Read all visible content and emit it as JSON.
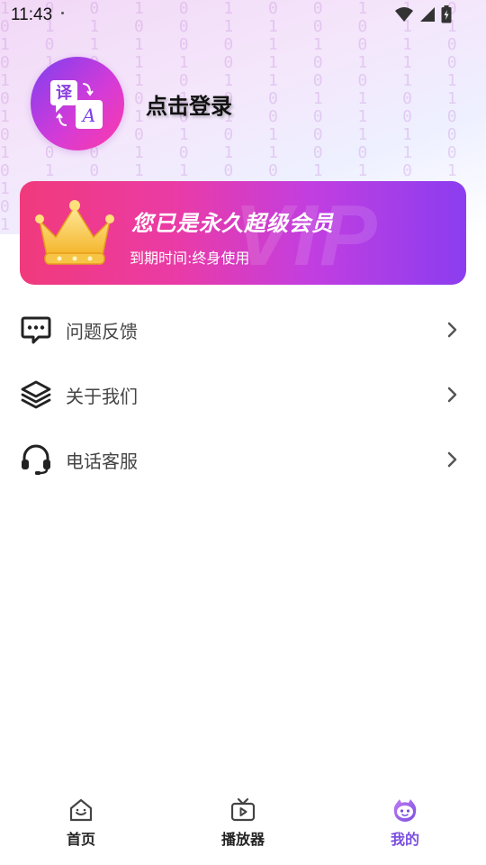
{
  "status_bar": {
    "time": "11:43"
  },
  "profile": {
    "login_label": "点击登录"
  },
  "vip_card": {
    "title": "您已是永久超级会员",
    "expiry": "到期时间:终身使用",
    "watermark": "VIP"
  },
  "menu": {
    "items": [
      {
        "label": "问题反馈",
        "icon": "feedback-chat-icon"
      },
      {
        "label": "关于我们",
        "icon": "layers-icon"
      },
      {
        "label": "电话客服",
        "icon": "headset-icon"
      }
    ]
  },
  "tabbar": {
    "tabs": [
      {
        "label": "首页",
        "icon": "home-icon"
      },
      {
        "label": "播放器",
        "icon": "tv-player-icon"
      },
      {
        "label": "我的",
        "icon": "profile-face-icon",
        "active": true
      }
    ]
  },
  "colors": {
    "accent": "#7b4fe0",
    "vip_gradient_start": "#f13a7c",
    "vip_gradient_end": "#8b3df0"
  }
}
